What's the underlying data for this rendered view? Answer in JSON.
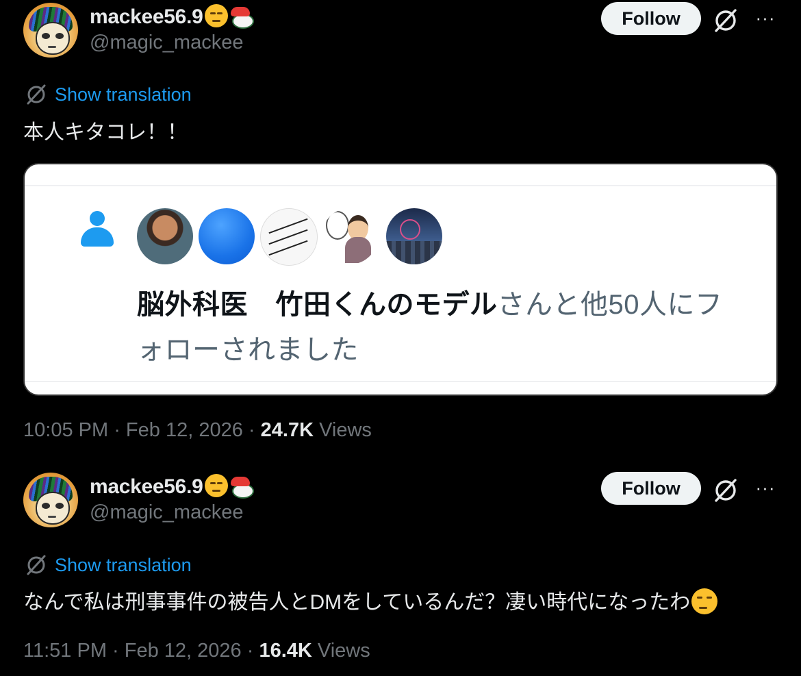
{
  "tweets": [
    {
      "display_name": "mackee56.9",
      "handle": "@magic_mackee",
      "follow_label": "Follow",
      "more_label": "···",
      "translate_label": "Show translation",
      "text": "本人キタコレ！！",
      "card": {
        "name_bold": "脳外科医　竹田くんのモデル",
        "rest_line1": "さんと他50人にフ",
        "line2": "ォローされました"
      },
      "time": "10:05 PM",
      "date": "Feb 12, 2026",
      "views_count": "24.7K",
      "views_label": "Views"
    },
    {
      "display_name": "mackee56.9",
      "handle": "@magic_mackee",
      "follow_label": "Follow",
      "more_label": "···",
      "translate_label": "Show translation",
      "text": "なんで私は刑事事件の被告人とDMをしているんだ？凄い時代になったわ",
      "time": "11:51 PM",
      "date": "Feb 12, 2026",
      "views_count": "16.4K",
      "views_label": "Views"
    }
  ],
  "colors": {
    "background": "#000000",
    "text": "#e7e9ea",
    "secondary": "#71767b",
    "link": "#1d9bf0",
    "follow_bg": "#eff3f4"
  },
  "icons": [
    "grok-icon",
    "more-icon",
    "translate-icon",
    "person-icon",
    "unamused-face-emoji",
    "sushi-emoji"
  ]
}
